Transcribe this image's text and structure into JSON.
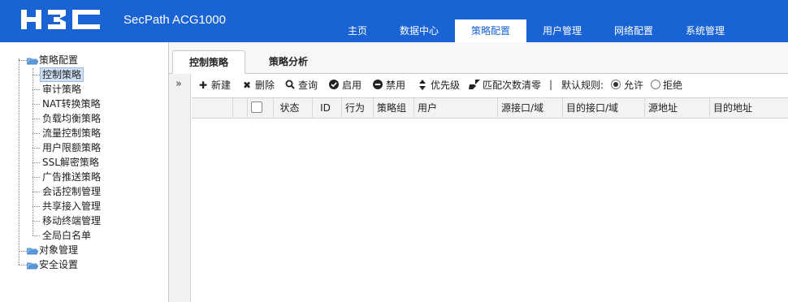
{
  "header": {
    "logo_text": "H3C",
    "product": "SecPath ACG1000",
    "nav": [
      {
        "label": "主页"
      },
      {
        "label": "数据中心"
      },
      {
        "label": "策略配置"
      },
      {
        "label": "用户管理"
      },
      {
        "label": "网络配置"
      },
      {
        "label": "系统管理"
      }
    ],
    "active_nav": "策略配置",
    "brand_color": "#1a63d4"
  },
  "sidebar": {
    "root": {
      "label": "策略配置",
      "icon": "folder-open-icon"
    },
    "children": [
      {
        "label": "控制策略",
        "selected": true
      },
      {
        "label": "审计策略"
      },
      {
        "label": "NAT转换策略"
      },
      {
        "label": "负载均衡策略"
      },
      {
        "label": "流量控制策略"
      },
      {
        "label": "用户限额策略"
      },
      {
        "label": "SSL解密策略"
      },
      {
        "label": "广告推送策略"
      },
      {
        "label": "会话控制管理"
      },
      {
        "label": "共享接入管理"
      },
      {
        "label": "移动终端管理"
      },
      {
        "label": "全局白名单"
      }
    ],
    "siblings": [
      {
        "label": "对象管理",
        "icon": "folder-icon"
      },
      {
        "label": "安全设置",
        "icon": "folder-icon"
      }
    ]
  },
  "tabs": [
    {
      "label": "控制策略",
      "active": true
    },
    {
      "label": "策略分析",
      "active": false
    }
  ],
  "collapse_glyph": "»",
  "toolbar": {
    "new": {
      "label": "新建",
      "icon": "plus-icon"
    },
    "delete": {
      "label": "删除",
      "icon": "x-icon"
    },
    "query": {
      "label": "查询",
      "icon": "search-icon"
    },
    "enable": {
      "label": "启用",
      "icon": "check-circle-icon"
    },
    "disable": {
      "label": "禁用",
      "icon": "minus-circle-icon"
    },
    "priority": {
      "label": "优先级",
      "icon": "sort-icon"
    },
    "clear_count": {
      "label": "匹配次数清零",
      "icon": "broom-icon"
    },
    "separator": "|",
    "default_rule_label": "默认规则:",
    "allow_label": "允许",
    "deny_label": "拒绝",
    "default_rule_value": "允许"
  },
  "table": {
    "columns": [
      "状态",
      "ID",
      "行为",
      "策略组",
      "用户",
      "源接口/域",
      "目的接口/域",
      "源地址",
      "目的地址"
    ],
    "rows": []
  }
}
